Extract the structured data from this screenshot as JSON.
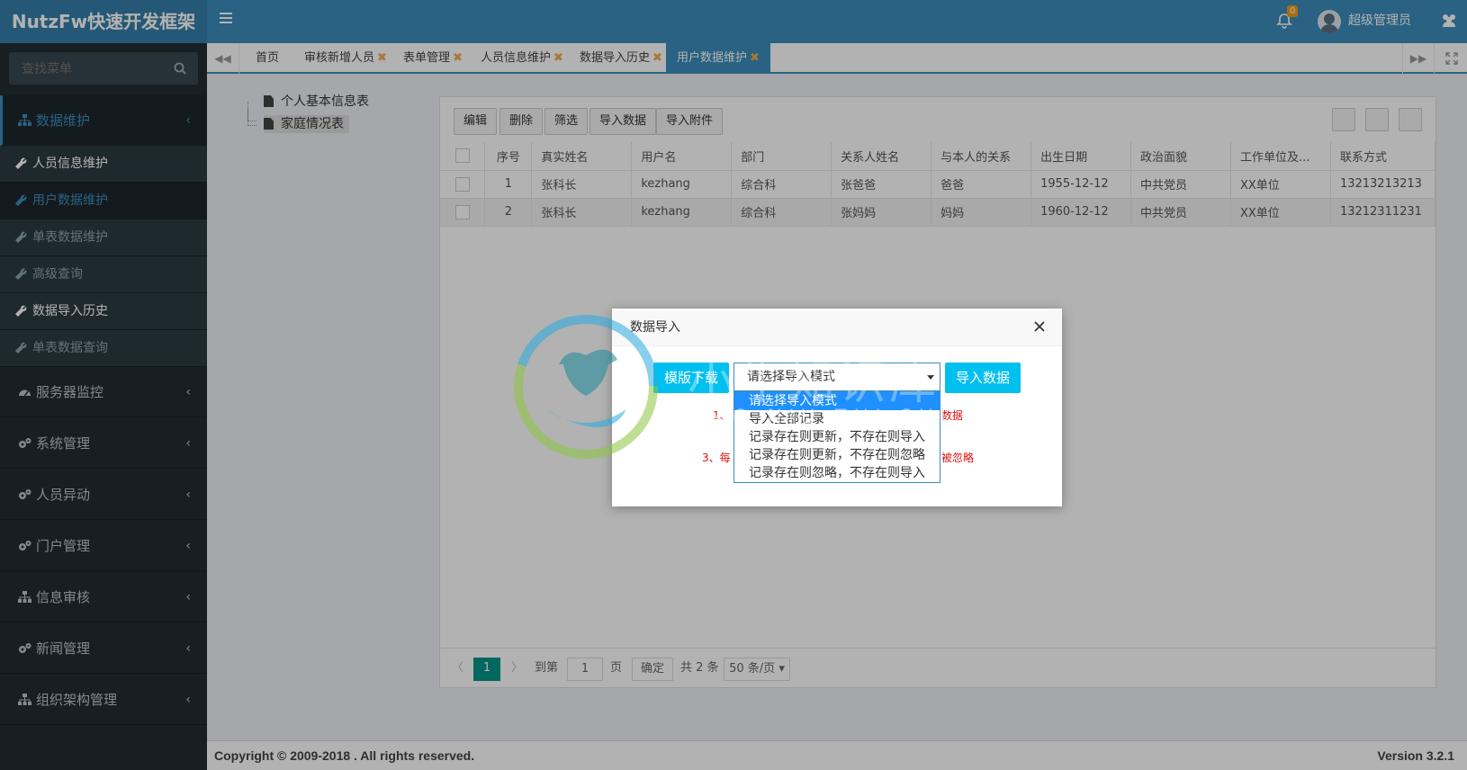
{
  "app": {
    "title": "NutzFw快速开发框架"
  },
  "header": {
    "notifications": "0",
    "username": "超级管理员"
  },
  "search": {
    "placeholder": "查找菜单"
  },
  "sidebar": {
    "groups": [
      {
        "label": "数据维护",
        "chevron": "‹"
      },
      {
        "label": "服务器监控",
        "chevron": "‹"
      },
      {
        "label": "系统管理",
        "chevron": "‹"
      },
      {
        "label": "人员异动",
        "chevron": "‹"
      },
      {
        "label": "门户管理",
        "chevron": "‹"
      },
      {
        "label": "信息审核",
        "chevron": "‹"
      },
      {
        "label": "新闻管理",
        "chevron": "‹"
      },
      {
        "label": "组织架构管理",
        "chevron": "‹"
      }
    ],
    "sub_items": [
      {
        "label": "人员信息维护"
      },
      {
        "label": "用户数据维护"
      },
      {
        "label": "单表数据维护"
      },
      {
        "label": "高级查询"
      },
      {
        "label": "数据导入历史"
      },
      {
        "label": "单表数据查询"
      }
    ]
  },
  "tabs": {
    "items": [
      {
        "label": "首页"
      },
      {
        "label": "审核新增人员",
        "close": "✖"
      },
      {
        "label": "表单管理",
        "close": "✖"
      },
      {
        "label": "人员信息维护",
        "close": "✖"
      },
      {
        "label": "数据导入历史",
        "close": "✖"
      },
      {
        "label": "用户数据维护",
        "close": "✖"
      }
    ],
    "nav_left": "◀◀",
    "nav_right": "▶▶"
  },
  "tree": {
    "items": [
      {
        "label": "个人基本信息表"
      },
      {
        "label": "家庭情况表"
      }
    ]
  },
  "toolbar": {
    "edit": "编辑",
    "delete": "删除",
    "filter": "筛选",
    "import": "导入数据",
    "attach": "导入附件"
  },
  "table": {
    "headers": [
      "序号",
      "真实姓名",
      "用户名",
      "部门",
      "关系人姓名",
      "与本人的关系",
      "出生日期",
      "政治面貌",
      "工作单位及...",
      "联系方式"
    ],
    "rows": [
      [
        "1",
        "张科长",
        "kezhang",
        "综合科",
        "张爸爸",
        "爸爸",
        "1955-12-12",
        "中共党员",
        "XX单位",
        "13213213213"
      ],
      [
        "2",
        "张科长",
        "kezhang",
        "综合科",
        "张妈妈",
        "妈妈",
        "1960-12-12",
        "中共党员",
        "XX单位",
        "13212311231"
      ]
    ]
  },
  "pager": {
    "current": "1",
    "goto": "到第",
    "page_input": "1",
    "page_unit": "页",
    "confirm": "确定",
    "total": "共 2 条",
    "page_size": "50 条/页"
  },
  "modal": {
    "title": "数据导入",
    "template_btn": "模版下载",
    "select_value": "请选择导入模式",
    "import_btn": "导入数据",
    "options": [
      "请选择导入模式",
      "导入全部记录",
      "记录存在则更新，不存在则导入",
      "记录存在则更新，不存在则忽略",
      "记录存在则忽略，不存在则导入"
    ],
    "note1_prefix": "1、",
    "note1_suffix": "数据",
    "note3_prefix": "3、每",
    "note3_suffix": "被忽略"
  },
  "watermark": {
    "text": "小牛知识库",
    "sub": "XIAO NIU ZHI SHI KU"
  },
  "footer": {
    "copyright": "Copyright © 2009-2018 . All rights reserved.",
    "version": "Version 3.2.1"
  },
  "colors": {
    "primary": "#3c8dbc",
    "sidebar": "#222d32",
    "accent": "#00c0ef",
    "pager": "#009688",
    "warn": "#f0ad4e"
  }
}
